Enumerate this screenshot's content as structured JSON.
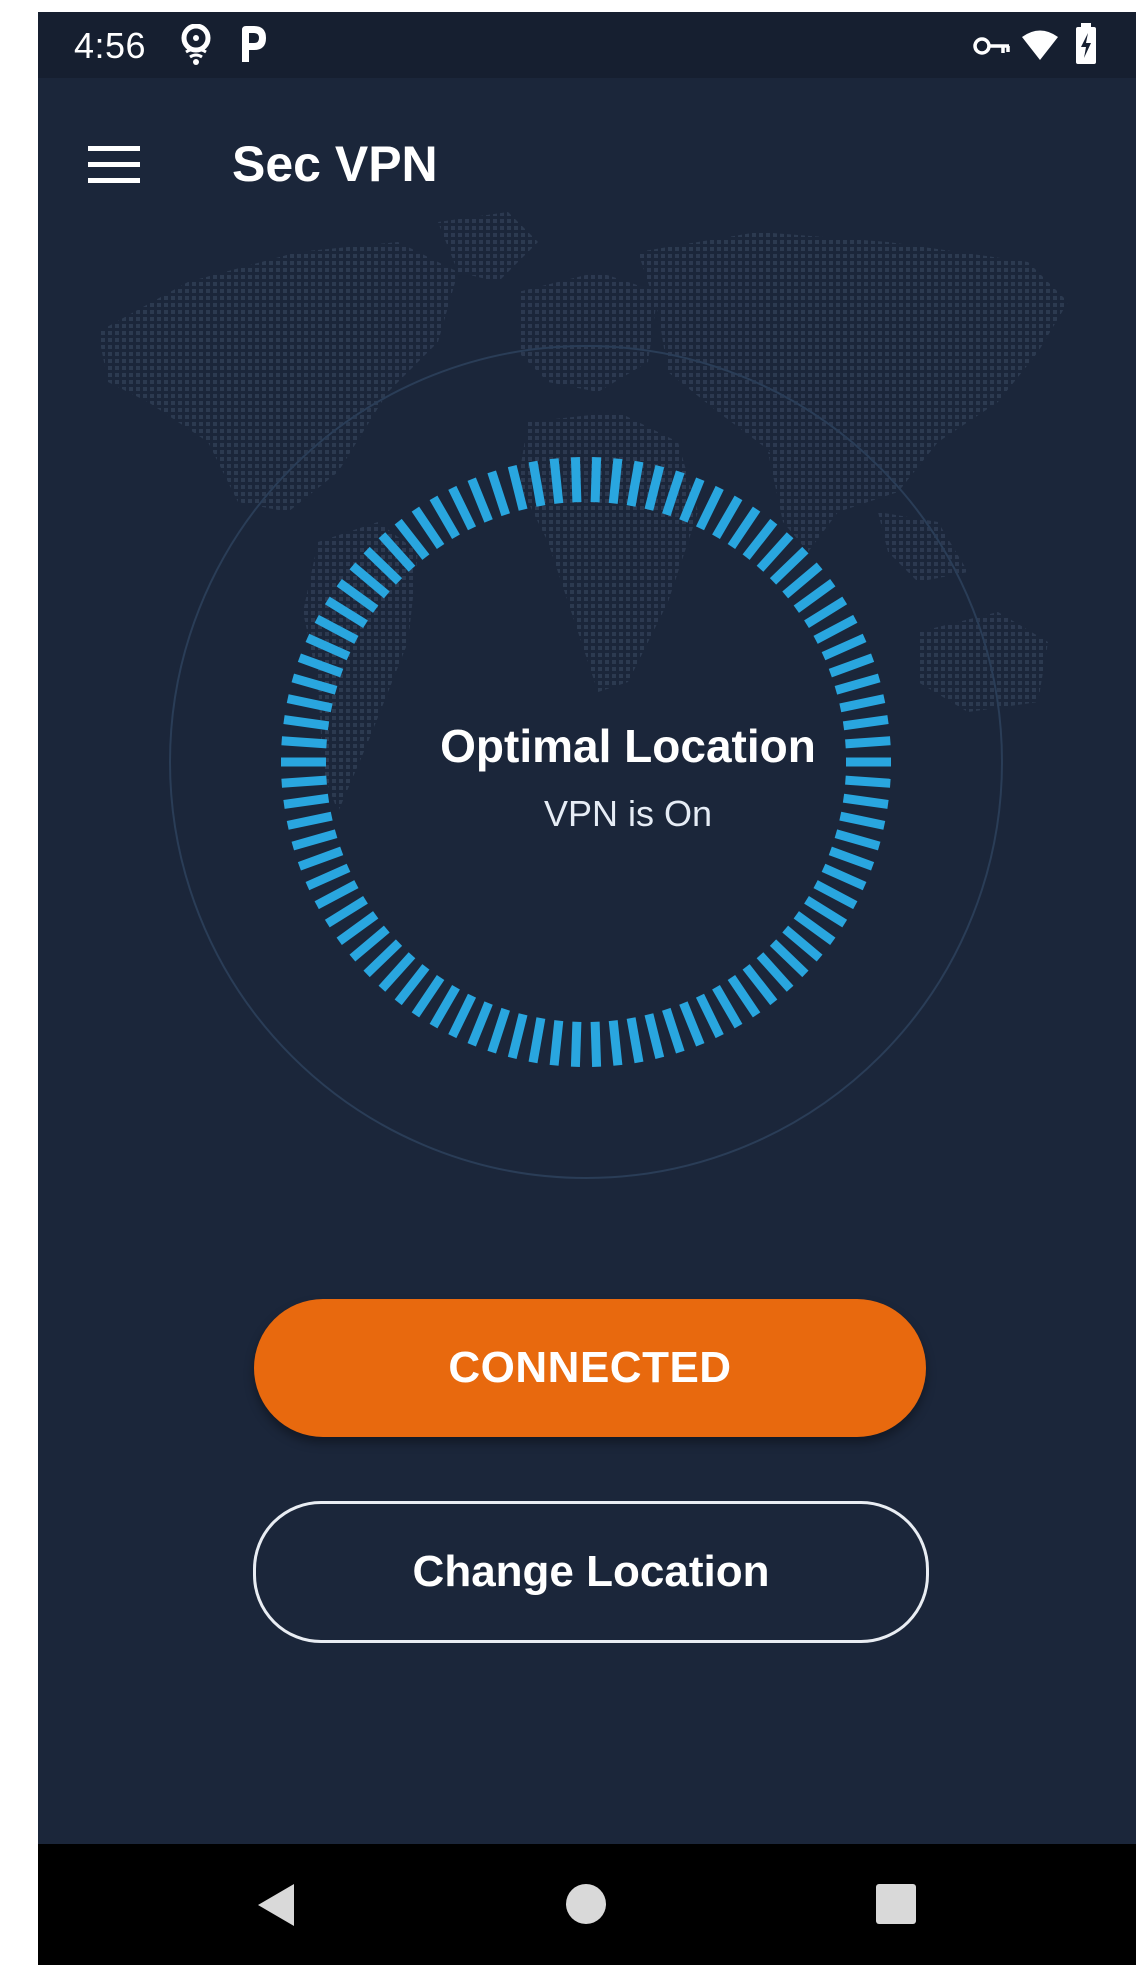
{
  "status_bar": {
    "time": "4:56",
    "left_icons": [
      "hotspot-icon",
      "parking-p-icon"
    ],
    "right_icons": [
      "vpn-key-icon",
      "wifi-icon",
      "battery-charging-icon"
    ]
  },
  "app_bar": {
    "title": "Sec VPN",
    "menu_icon": "hamburger-menu-icon"
  },
  "dial": {
    "title": "Optimal Location",
    "subtitle": "VPN is On",
    "tick_color": "#29a6df"
  },
  "buttons": {
    "connect_label": "CONNECTED",
    "change_location_label": "Change Location"
  },
  "nav_bar": {
    "icons": [
      "back-icon",
      "home-icon",
      "recents-icon"
    ]
  },
  "colors": {
    "background": "#1b263a",
    "status_bar": "#161f30",
    "accent_orange": "#e8690e",
    "accent_blue": "#29a6df"
  }
}
